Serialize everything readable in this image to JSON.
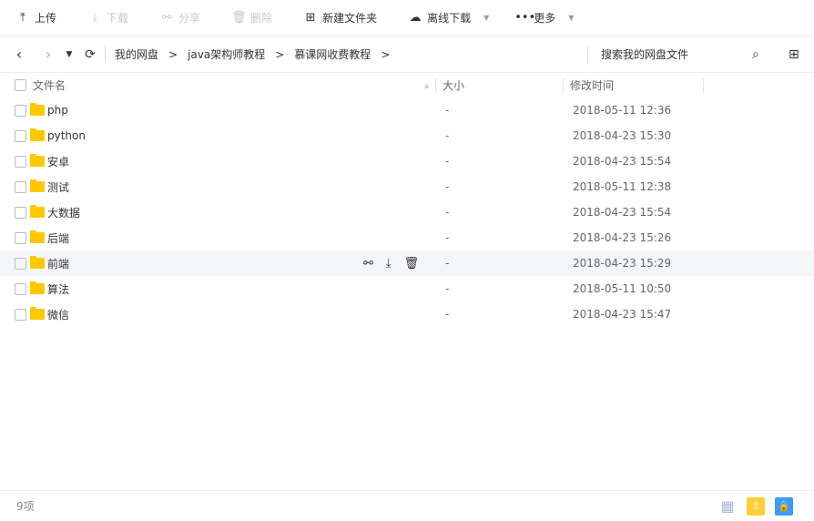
{
  "toolbar": {
    "upload": "上传",
    "download": "下载",
    "share": "分享",
    "delete": "删除",
    "new_folder": "新建文件夹",
    "offline_download": "离线下载",
    "more": "更多"
  },
  "breadcrumb": [
    "我的网盘",
    "java架构师教程",
    "慕课网收费教程"
  ],
  "search_placeholder": "搜索我的网盘文件",
  "columns": {
    "name": "文件名",
    "size": "大小",
    "time": "修改时间"
  },
  "files": [
    {
      "name": "php",
      "size": "-",
      "time": "2018-05-11 12:36"
    },
    {
      "name": "python",
      "size": "-",
      "time": "2018-04-23 15:30"
    },
    {
      "name": "安卓",
      "size": "-",
      "time": "2018-04-23 15:54"
    },
    {
      "name": "测试",
      "size": "-",
      "time": "2018-05-11 12:38"
    },
    {
      "name": "大数据",
      "size": "-",
      "time": "2018-04-23 15:54"
    },
    {
      "name": "后端",
      "size": "-",
      "time": "2018-04-23 15:26"
    },
    {
      "name": "前端",
      "size": "-",
      "time": "2018-04-23 15:29"
    },
    {
      "name": "算法",
      "size": "-",
      "time": "2018-05-11 10:50"
    },
    {
      "name": "微信",
      "size": "-",
      "time": "2018-04-23 15:47"
    }
  ],
  "footer": {
    "count": "9项"
  }
}
